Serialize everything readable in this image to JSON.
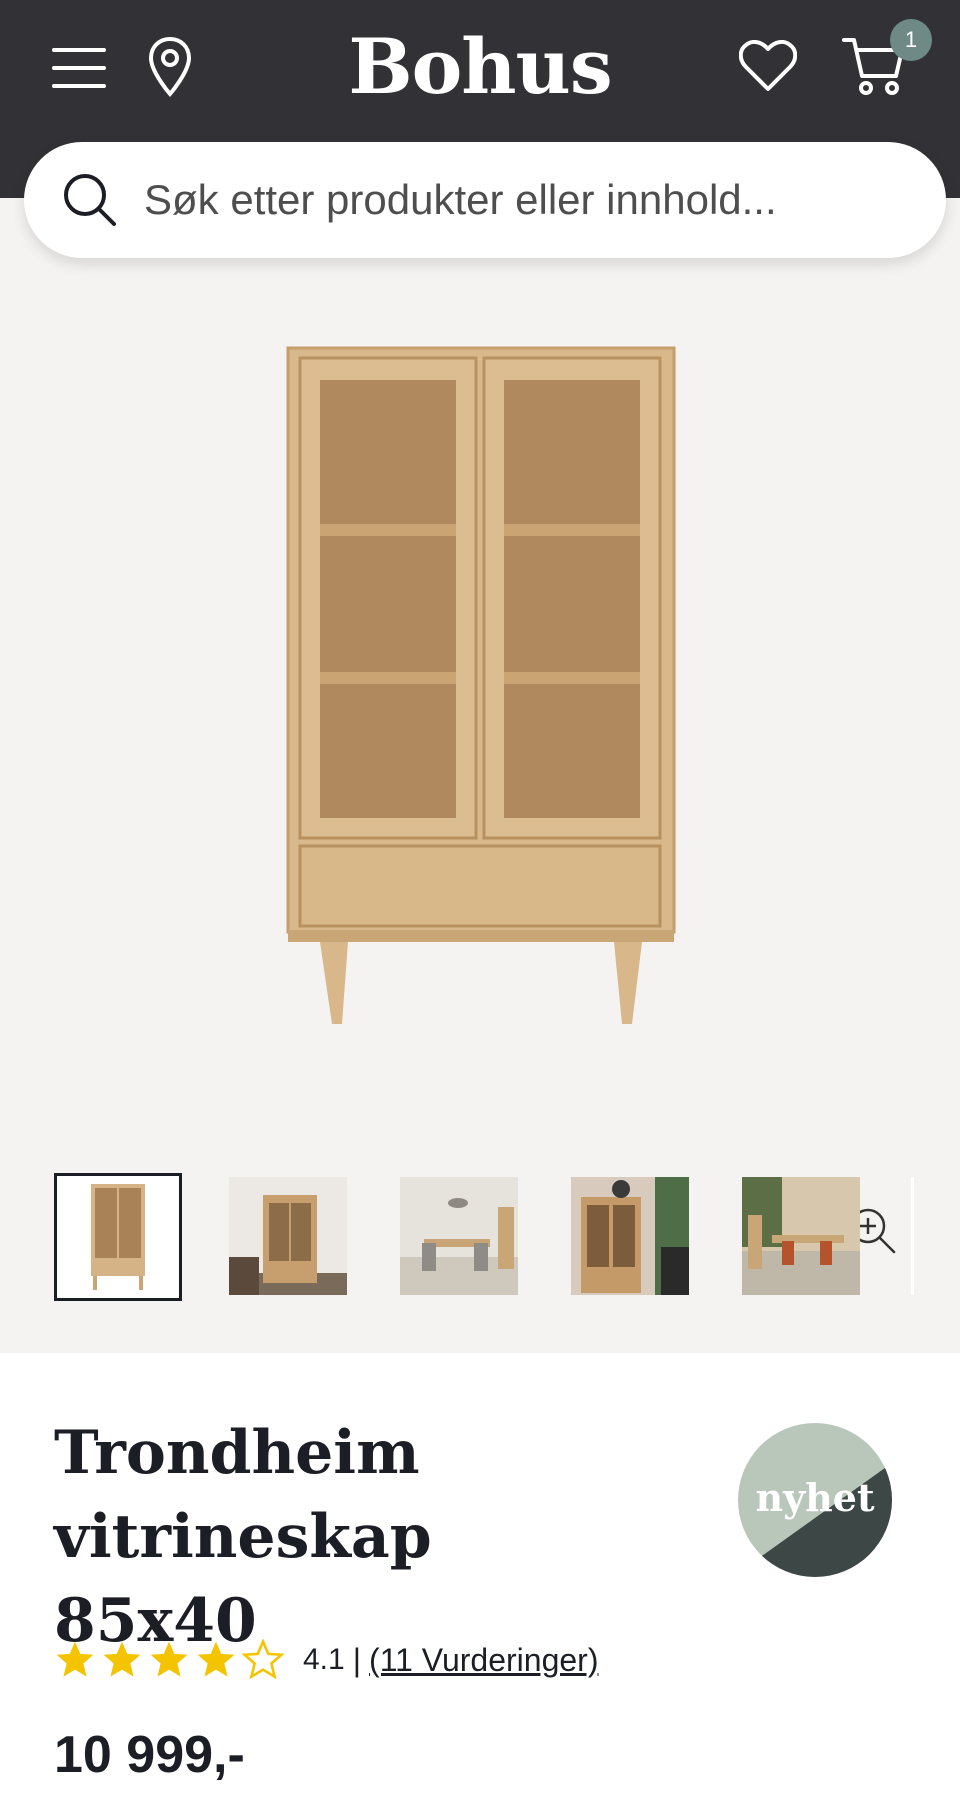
{
  "header": {
    "logo": "Bohus",
    "cart_count": "1",
    "colors": {
      "background": "#323136",
      "badge": "#6f8a86"
    },
    "icons": [
      "menu-icon",
      "location-icon",
      "heart-icon",
      "cart-icon"
    ]
  },
  "search": {
    "placeholder": "Søk etter produkter eller innhold..."
  },
  "gallery": {
    "thumbnail_count": 5,
    "active_thumbnail": 1
  },
  "product": {
    "title_line1": "Trondheim",
    "title_line2": "vitrineskap 85x40",
    "badge": "nyhet",
    "rating": {
      "stars": 4,
      "max": 5,
      "value": "4.1",
      "separator": "|",
      "reviews_link": "(11 Vurderinger)"
    },
    "price": "10 999,-",
    "colors": {
      "star": "#f5c400",
      "badge_light": "#b9c7bb",
      "badge_dark": "#3d4745"
    }
  }
}
